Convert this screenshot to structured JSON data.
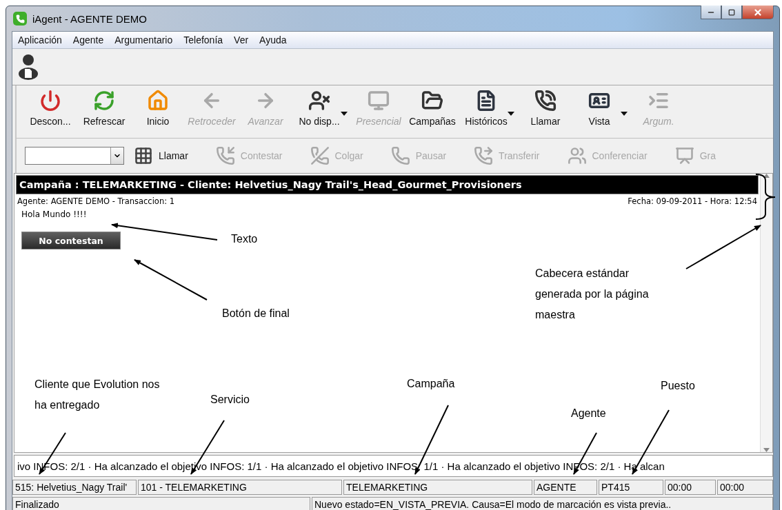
{
  "window": {
    "title": "iAgent - AGENTE DEMO"
  },
  "menu": [
    "Aplicación",
    "Agente",
    "Argumentario",
    "Telefonía",
    "Ver",
    "Ayuda"
  ],
  "toolbar": {
    "items": [
      {
        "label": "Descon...",
        "disabled": false,
        "dropdown": false
      },
      {
        "label": "Refrescar",
        "disabled": false,
        "dropdown": false
      },
      {
        "label": "Inicio",
        "disabled": false,
        "dropdown": false
      },
      {
        "label": "Retroceder",
        "disabled": true,
        "dropdown": false
      },
      {
        "label": "Avanzar",
        "disabled": true,
        "dropdown": false
      },
      {
        "label": "No disp...",
        "disabled": false,
        "dropdown": true
      },
      {
        "label": "Presencial",
        "disabled": true,
        "dropdown": false
      },
      {
        "label": "Campañas",
        "disabled": false,
        "dropdown": false
      },
      {
        "label": "Históricos",
        "disabled": false,
        "dropdown": true
      },
      {
        "label": "Llamar",
        "disabled": false,
        "dropdown": false
      },
      {
        "label": "Vista",
        "disabled": false,
        "dropdown": true
      },
      {
        "label": "Argum.",
        "disabled": true,
        "dropdown": false
      }
    ]
  },
  "callbar": {
    "items": [
      {
        "label": "Llamar",
        "disabled": false
      },
      {
        "label": "Contestar",
        "disabled": true
      },
      {
        "label": "Colgar",
        "disabled": true
      },
      {
        "label": "Pausar",
        "disabled": true
      },
      {
        "label": "Transferir",
        "disabled": true
      },
      {
        "label": "Conferenciar",
        "disabled": true
      },
      {
        "label": "Gra",
        "disabled": true
      }
    ]
  },
  "script_panel": {
    "title": "Campaña : TELEMARKETING - Cliente: Helvetius_Nagy Trail's_Head_Gourmet_Provisioners",
    "agent_line": "Agente: AGENTE DEMO  - Transaccion: 1",
    "date_line": "Fecha: 09-09-2011 - Hora: 12:54",
    "text": "Hola Mundo !!!!",
    "end_button": "No contestan"
  },
  "ticker": "ivo INFOS: 2/1 · Ha alcanzado el objetivo INFOS: 1/1 · Ha alcanzado el objetivo INFOS: 1/1 · Ha alcanzado el objetivo INFOS: 2/1 · Ha alcan",
  "status_bar": {
    "row_1": [
      "515: Helvetius_Nagy Trail'",
      "101 - TELEMARKETING",
      "TELEMARKETING",
      "AGENTE",
      "PT415",
      "00:00",
      "00:00"
    ],
    "row_2": [
      "Finalizado",
      "Nuevo estado=EN_VISTA_PREVIA. Causa=El modo de marcación es vista previa.."
    ]
  },
  "annotations": [
    {
      "text": "Texto"
    },
    {
      "text": "Botón de final"
    },
    {
      "text": "Cabecera estándar generada por la página maestra"
    },
    {
      "text": "Cliente que Evolution nos ha entregado"
    },
    {
      "text": "Servicio"
    },
    {
      "text": "Campaña"
    },
    {
      "text": "Agente"
    },
    {
      "text": "Puesto"
    }
  ]
}
